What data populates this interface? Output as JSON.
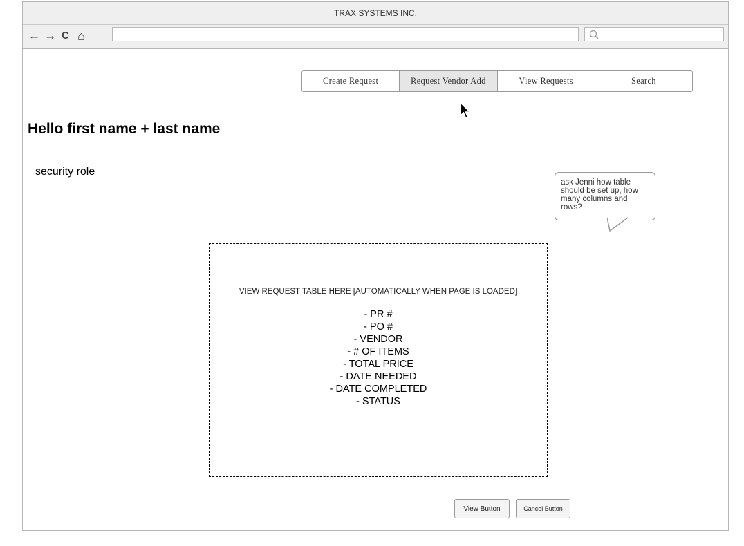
{
  "window": {
    "title": "TRAX SYSTEMS INC."
  },
  "toolbar": {
    "icons": [
      "back-icon",
      "forward-icon",
      "reload-icon",
      "home-icon",
      "search-icon"
    ],
    "glyphs": {
      "back": "←",
      "forward": "→",
      "reload": "C",
      "home": "⌂"
    },
    "url_value": "",
    "search_value": ""
  },
  "nav": {
    "tabs": [
      {
        "label": "Create Request"
      },
      {
        "label": "Request Vendor Add",
        "active": true
      },
      {
        "label": "View Requests"
      },
      {
        "label": "Search"
      }
    ]
  },
  "main": {
    "greeting": "Hello first name + last name",
    "security_role": "security role",
    "note": "ask Jenni how table should be set up, how many columns and rows?",
    "placeholder": {
      "title": "VIEW REQUEST TABLE HERE [AUTOMATICALLY WHEN PAGE IS LOADED]",
      "fields": [
        "- PR #",
        "- PO #",
        "- VENDOR",
        "- # OF ITEMS",
        "- TOTAL PRICE",
        "- DATE NEEDED",
        "- DATE COMPLETED",
        "- STATUS"
      ]
    },
    "buttons": {
      "view": "View Button",
      "cancel": "Cancel Button"
    }
  }
}
